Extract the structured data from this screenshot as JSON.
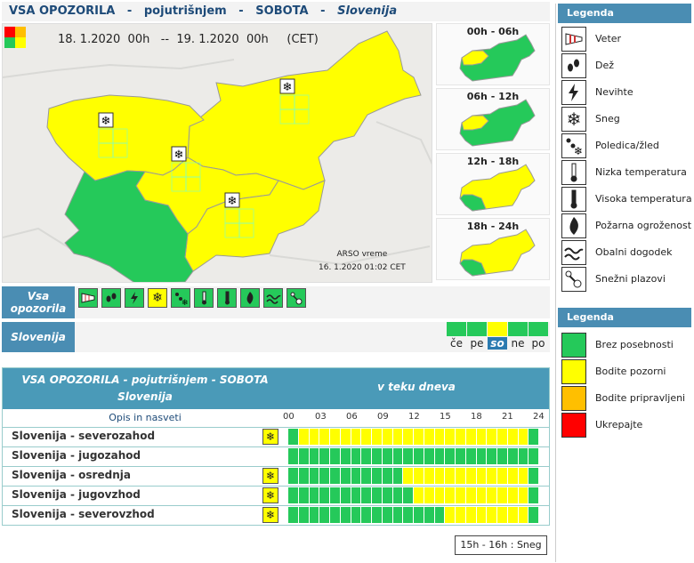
{
  "header": {
    "title": "VSA OPOZORILA",
    "sep": "-",
    "subtitle": "pojutrišnjem",
    "day": "SOBOTA",
    "region": "Slovenija"
  },
  "map": {
    "period": "18. 1.2020  00h   --  19. 1.2020  00h     (CET)",
    "credit_line1": "ARSO vreme",
    "credit_line2": "16. 1.2020  01:02 CET",
    "thumbnails": [
      {
        "label": "00h - 06h"
      },
      {
        "label": "06h - 12h"
      },
      {
        "label": "12h - 18h"
      },
      {
        "label": "18h - 24h"
      }
    ]
  },
  "type_strip": {
    "label_line1": "Vsa",
    "label_line2": "opozorila",
    "buttons": [
      {
        "icon": "wind-icon",
        "level": "green"
      },
      {
        "icon": "rain-icon",
        "level": "green"
      },
      {
        "icon": "thunderstorm-icon",
        "level": "green"
      },
      {
        "icon": "snow-icon",
        "level": "yellow"
      },
      {
        "icon": "ice-icon",
        "level": "green"
      },
      {
        "icon": "low-temperature-icon",
        "level": "green"
      },
      {
        "icon": "high-temperature-icon",
        "level": "green"
      },
      {
        "icon": "fire-icon",
        "level": "green"
      },
      {
        "icon": "coastal-icon",
        "level": "green"
      },
      {
        "icon": "snow-drift-icon",
        "level": "green"
      }
    ]
  },
  "day_strip": {
    "label": "Slovenija",
    "days": [
      {
        "name": "če",
        "level": "green",
        "selected": false
      },
      {
        "name": "pe",
        "level": "green",
        "selected": false
      },
      {
        "name": "so",
        "level": "yellow",
        "selected": true
      },
      {
        "name": "ne",
        "level": "green",
        "selected": false
      },
      {
        "name": "po",
        "level": "green",
        "selected": false
      }
    ]
  },
  "table": {
    "title_line1": "VSA OPOZORILA - pojutrišnjem - SOBOTA",
    "title_line2": "Slovenija",
    "col2": "v teku dneva",
    "opis": "Opis in nasveti",
    "hours": [
      "00",
      "03",
      "06",
      "09",
      "12",
      "15",
      "18",
      "21",
      "24"
    ],
    "rows": [
      {
        "name": "Slovenija - severozahod",
        "icon": "snow-icon",
        "levels": [
          "g",
          "y",
          "y",
          "y",
          "y",
          "y",
          "y",
          "y",
          "y",
          "y",
          "y",
          "y",
          "y",
          "y",
          "y",
          "y",
          "y",
          "y",
          "y",
          "y",
          "y",
          "y",
          "y",
          "g"
        ]
      },
      {
        "name": "Slovenija - jugozahod",
        "icon": "",
        "levels": [
          "g",
          "g",
          "g",
          "g",
          "g",
          "g",
          "g",
          "g",
          "g",
          "g",
          "g",
          "g",
          "g",
          "g",
          "g",
          "g",
          "g",
          "g",
          "g",
          "g",
          "g",
          "g",
          "g",
          "g"
        ]
      },
      {
        "name": "Slovenija - osrednja",
        "icon": "snow-icon",
        "levels": [
          "g",
          "g",
          "g",
          "g",
          "g",
          "g",
          "g",
          "g",
          "g",
          "g",
          "g",
          "y",
          "y",
          "y",
          "y",
          "y",
          "y",
          "y",
          "y",
          "y",
          "y",
          "y",
          "y",
          "g"
        ]
      },
      {
        "name": "Slovenija - jugovzhod",
        "icon": "snow-icon",
        "levels": [
          "g",
          "g",
          "g",
          "g",
          "g",
          "g",
          "g",
          "g",
          "g",
          "g",
          "g",
          "g",
          "y",
          "y",
          "y",
          "y",
          "y",
          "y",
          "y",
          "y",
          "y",
          "y",
          "y",
          "g"
        ]
      },
      {
        "name": "Slovenija - severovzhod",
        "icon": "snow-icon",
        "levels": [
          "g",
          "g",
          "g",
          "g",
          "g",
          "g",
          "g",
          "g",
          "g",
          "g",
          "g",
          "g",
          "g",
          "g",
          "g",
          "y",
          "y",
          "y",
          "y",
          "y",
          "y",
          "y",
          "y",
          "g"
        ]
      }
    ]
  },
  "tooltip": "15h - 16h : Sneg",
  "legend_types": {
    "title": "Legenda",
    "items": [
      {
        "icon": "wind-icon",
        "label": "Veter"
      },
      {
        "icon": "rain-icon",
        "label": "Dež"
      },
      {
        "icon": "thunderstorm-icon",
        "label": "Nevihte"
      },
      {
        "icon": "snow-icon",
        "label": "Sneg"
      },
      {
        "icon": "ice-icon",
        "label": "Poledica/žled"
      },
      {
        "icon": "low-temperature-icon",
        "label": "Nizka temperatura"
      },
      {
        "icon": "high-temperature-icon",
        "label": "Visoka temperatura"
      },
      {
        "icon": "fire-icon",
        "label": "Požarna ogroženost"
      },
      {
        "icon": "coastal-icon",
        "label": "Obalni dogodek"
      },
      {
        "icon": "snow-drift-icon",
        "label": "Snežni plazovi"
      }
    ]
  },
  "legend_levels": {
    "title": "Legenda",
    "items": [
      {
        "color": "#25c95a",
        "label": "Brez posebnosti"
      },
      {
        "color": "#ffff00",
        "label": "Bodite pozorni"
      },
      {
        "color": "#ffbf00",
        "label": "Bodite pripravljeni"
      },
      {
        "color": "#ff0000",
        "label": "Ukrepajte"
      }
    ]
  },
  "colors": {
    "green": "#25c95a",
    "yellow": "#ffff00",
    "header_blue": "#4a8db3"
  }
}
